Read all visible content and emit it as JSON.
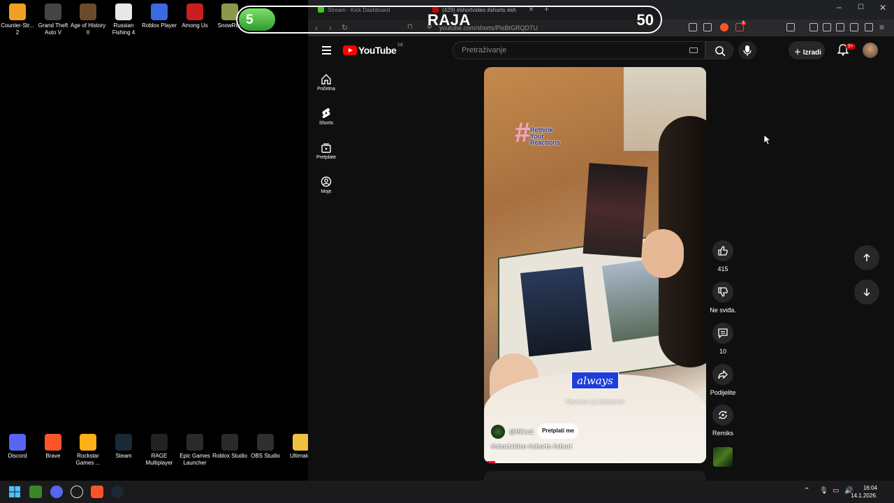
{
  "desktop": {
    "top_icons": [
      {
        "label": "Counter-Strike 2",
        "display": "Counter-Str... 2",
        "icon": "counter-strike-icon",
        "color": "#f0a020"
      },
      {
        "label": "Grand Theft Auto V",
        "display": "Grand Theft Auto V",
        "icon": "gta-icon",
        "color": "#444444"
      },
      {
        "label": "Age of History II",
        "display": "Age of History II",
        "icon": "age-of-history-icon",
        "color": "#6a4a2a"
      },
      {
        "label": "Russian Fishing 4",
        "display": "Russian Fishing 4",
        "icon": "russian-fishing-icon",
        "color": "#e8e8e8"
      },
      {
        "label": "Roblox Player",
        "display": "Roblox Player",
        "icon": "roblox-icon",
        "color": "#3a6ae0"
      },
      {
        "label": "Among Us",
        "display": "Among Us",
        "icon": "among-us-icon",
        "color": "#c81e1e"
      },
      {
        "label": "SnowRunner",
        "display": "SnowRun",
        "icon": "snowrunner-icon",
        "color": "#8a9a4a"
      }
    ],
    "bottom_icons": [
      {
        "label": "Discord",
        "display": "Discord",
        "icon": "discord-icon",
        "color": "#5865f2"
      },
      {
        "label": "Brave",
        "display": "Brave",
        "icon": "brave-icon",
        "color": "#fb542b"
      },
      {
        "label": "Rockstar Games Launcher",
        "display": "Rockstar Games ...",
        "icon": "rockstar-icon",
        "color": "#fcaf17"
      },
      {
        "label": "Steam",
        "display": "Steam",
        "icon": "steam-icon",
        "color": "#1b2838"
      },
      {
        "label": "RAGE Multiplayer",
        "display": "RAGE Multiplayer",
        "icon": "rage-mp-icon",
        "color": "#222222"
      },
      {
        "label": "Epic Games Launcher",
        "display": "Epic Games Launcher",
        "icon": "epic-games-icon",
        "color": "#2a2a2a"
      },
      {
        "label": "Roblox Studio",
        "display": "Roblox Studio",
        "icon": "roblox-studio-icon",
        "color": "#2a2a2a"
      },
      {
        "label": "OBS Studio",
        "display": "OBS Studio",
        "icon": "obs-icon",
        "color": "#302e31"
      },
      {
        "label": "Ultimate-",
        "display": "Ultimate-",
        "icon": "folder-icon",
        "color": "#f0c040"
      }
    ]
  },
  "overlay": {
    "score": "5",
    "name": "RAJA",
    "number": "50"
  },
  "browser": {
    "tabs": [
      {
        "title": "Stream - Kick Dashboard",
        "color": "#53fc18"
      },
      {
        "title": "(429) #shortvideo #shorts #sh",
        "color": "#ff0000"
      }
    ],
    "url": "youtube.com/shorts/PisBtGRQDTU",
    "extension_badge": "1"
  },
  "youtube": {
    "logo_text": "YouTube",
    "country_code": "DE",
    "search_placeholder": "Pretraživanje",
    "create_label": "Izradi",
    "notification_count": "9+",
    "sidebar": [
      {
        "label": "Početna",
        "icon": "home-icon"
      },
      {
        "label": "Shorts",
        "icon": "shorts-icon"
      },
      {
        "label": "Pretplate",
        "icon": "subscriptions-icon"
      },
      {
        "label": "Moje",
        "icon": "account-icon"
      }
    ],
    "short": {
      "sticker_lines": [
        "Rethink",
        "Your",
        "Reactions"
      ],
      "brand": "always",
      "subtitle": "Nevena i ja delujemo",
      "channel": "@Rilee1",
      "subscribe_label": "Pretplati me",
      "tags": "#shortvideo #shorts #short",
      "progress": 0.05
    },
    "actions": {
      "likes": "415",
      "dislike_label": "Ne sviđa.",
      "comments": "10",
      "share_label": "Podijelite",
      "remix_label": "Remiks"
    }
  },
  "taskbar": {
    "time": "16:04",
    "date": "14.1.2026."
  }
}
